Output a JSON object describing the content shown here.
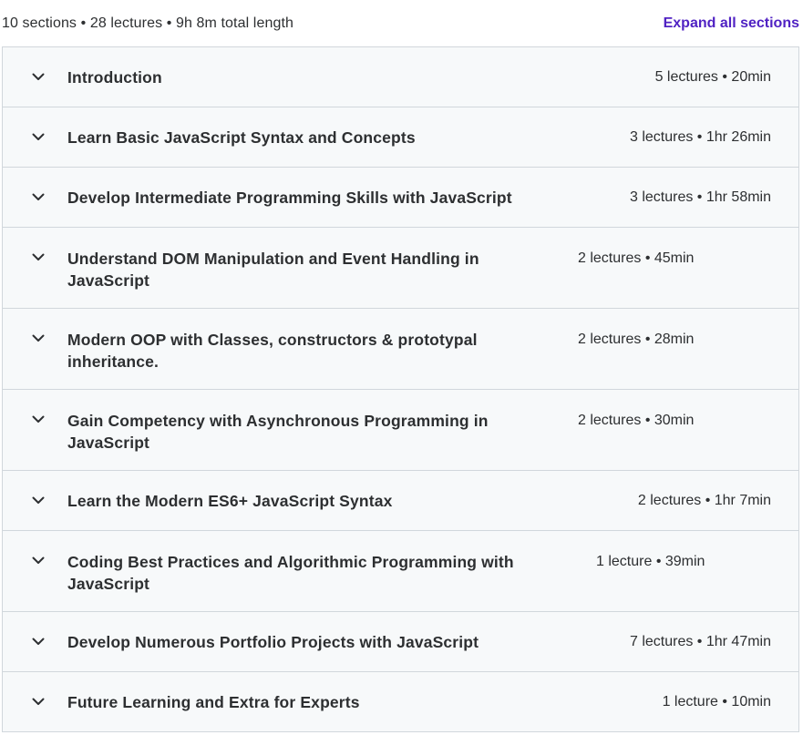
{
  "header": {
    "summary": "10 sections • 28 lectures • 9h 8m total length",
    "expand_label": "Expand all sections"
  },
  "colors": {
    "accent": "#5022c3",
    "section_bg": "#f7f9fa",
    "border": "#d1d7dc",
    "text": "#2d2f31"
  },
  "sections": [
    {
      "title": "Introduction",
      "meta": "5 lectures • 20min",
      "icon": "chevron-down-icon"
    },
    {
      "title": "Learn Basic JavaScript Syntax and Concepts",
      "meta": "3 lectures • 1hr 26min",
      "icon": "chevron-down-icon"
    },
    {
      "title": "Develop Intermediate Programming Skills with JavaScript",
      "meta": "3 lectures • 1hr 58min",
      "icon": "chevron-down-icon"
    },
    {
      "title": "Understand DOM Manipulation and Event Handling in JavaScript",
      "meta": "2 lectures • 45min",
      "icon": "chevron-down-icon"
    },
    {
      "title": "Modern OOP with Classes, constructors & prototypal inheritance.",
      "meta": "2 lectures • 28min",
      "icon": "chevron-down-icon"
    },
    {
      "title": "Gain Competency with Asynchronous Programming in JavaScript",
      "meta": "2 lectures • 30min",
      "icon": "chevron-down-icon"
    },
    {
      "title": "Learn the Modern ES6+ JavaScript Syntax",
      "meta": "2 lectures • 1hr 7min",
      "icon": "chevron-down-icon"
    },
    {
      "title": "Coding Best Practices and Algorithmic Programming with JavaScript",
      "meta": "1 lecture • 39min",
      "icon": "chevron-down-icon"
    },
    {
      "title": "Develop Numerous Portfolio Projects with JavaScript",
      "meta": "7 lectures • 1hr 47min",
      "icon": "chevron-down-icon"
    },
    {
      "title": "Future Learning and Extra for Experts",
      "meta": "1 lecture • 10min",
      "icon": "chevron-down-icon"
    }
  ]
}
